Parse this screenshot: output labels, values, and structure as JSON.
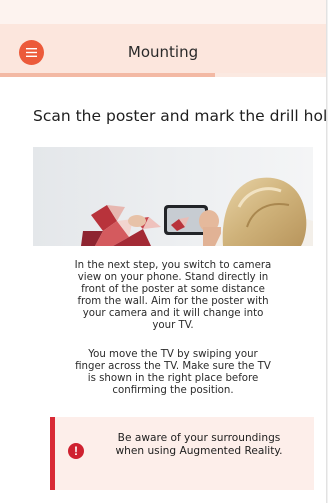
{
  "header": {
    "title": "Mounting",
    "menu_icon": "hamburger-menu-icon"
  },
  "progress": {
    "fraction": 0.66
  },
  "main": {
    "title": "Scan the poster and mark the drill hole",
    "image_description_icon": "person-holding-phone-photo",
    "paragraph_1": "In the next step, you switch to camera\nview on your phone. Stand directly in\nfront of the poster at some distance\nfrom the wall. Aim for the poster with\nyour camera and it will change into\nyour TV.",
    "paragraph_2": "You move the TV by swiping your\nfinger across the TV. Make sure the TV\nis shown in the right place before\nconfirming the position."
  },
  "warning": {
    "icon": "exclamation-circle-icon",
    "icon_glyph": "!",
    "text": "Be aware of your surroundings\nwhen using Augmented Reality."
  },
  "colors": {
    "accent": "#ec5a3a",
    "header_bg": "#fce6dd",
    "progress": "#f3b9a4",
    "warning_bar": "#d92a35",
    "warning_bg": "#fdeeea"
  }
}
